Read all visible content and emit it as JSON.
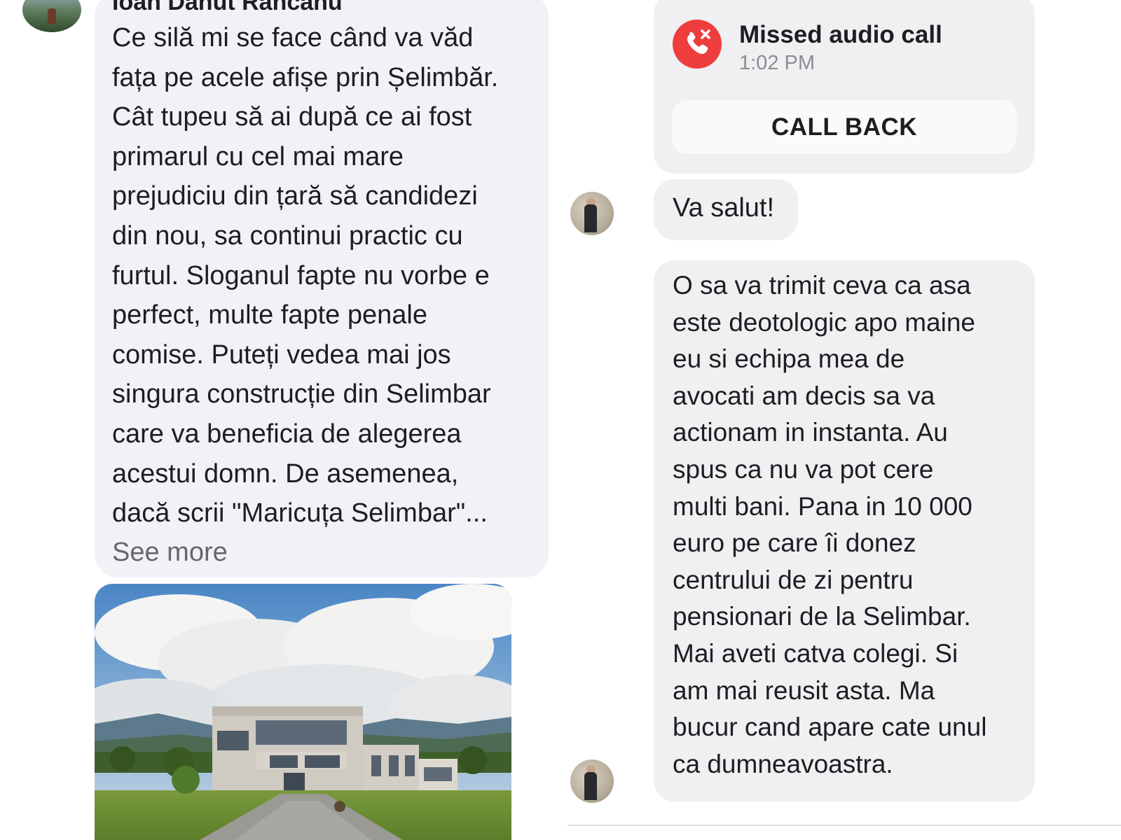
{
  "comment": {
    "author": "Ioan Danut Rancanu",
    "lines": [
      "Ce silă mi se face când va văd",
      "fața pe acele afișe prin Șelimbăr.",
      "Cât tupeu să ai după ce ai fost",
      "primarul cu cel mai mare",
      "prejudiciu din țară să candidezi",
      "din nou, sa continui practic cu",
      "furtul. Sloganul fapte nu vorbe e",
      "perfect, multe fapte penale",
      "comise. Puteți vedea mai jos",
      "singura construcție din Selimbar",
      "care va beneficia de alegerea",
      "acestui domn. De asemenea,",
      "dacă scrii \"Maricuța Selimbar\"..."
    ],
    "see_more": "See more"
  },
  "missed_call": {
    "title": "Missed audio call",
    "time": "1:02 PM",
    "call_back_label": "CALL BACK",
    "icon": "missed-call-icon",
    "icon_color": "#ee3d3d"
  },
  "messages": {
    "greeting": "Va salut!",
    "long_lines": [
      "O sa va trimit ceva ca asa",
      "este deotologic apo maine",
      "eu si echipa mea de",
      "avocati am decis sa va",
      "actionam in instanta. Au",
      "spus ca nu va pot cere",
      "multi bani. Pana in 10 000",
      "euro pe care îi donez",
      "centrului de zi pentru",
      "pensionari de la Selimbar.",
      "Mai aveti catva colegi. Si",
      "am mai reusit asta. Ma",
      "bucur cand apare cate unul",
      "ca dumneavoastra."
    ]
  },
  "colors": {
    "bubble_bg": "#f0f2f5",
    "secondary_text": "#65676b",
    "missed_red": "#ee3d3d"
  }
}
